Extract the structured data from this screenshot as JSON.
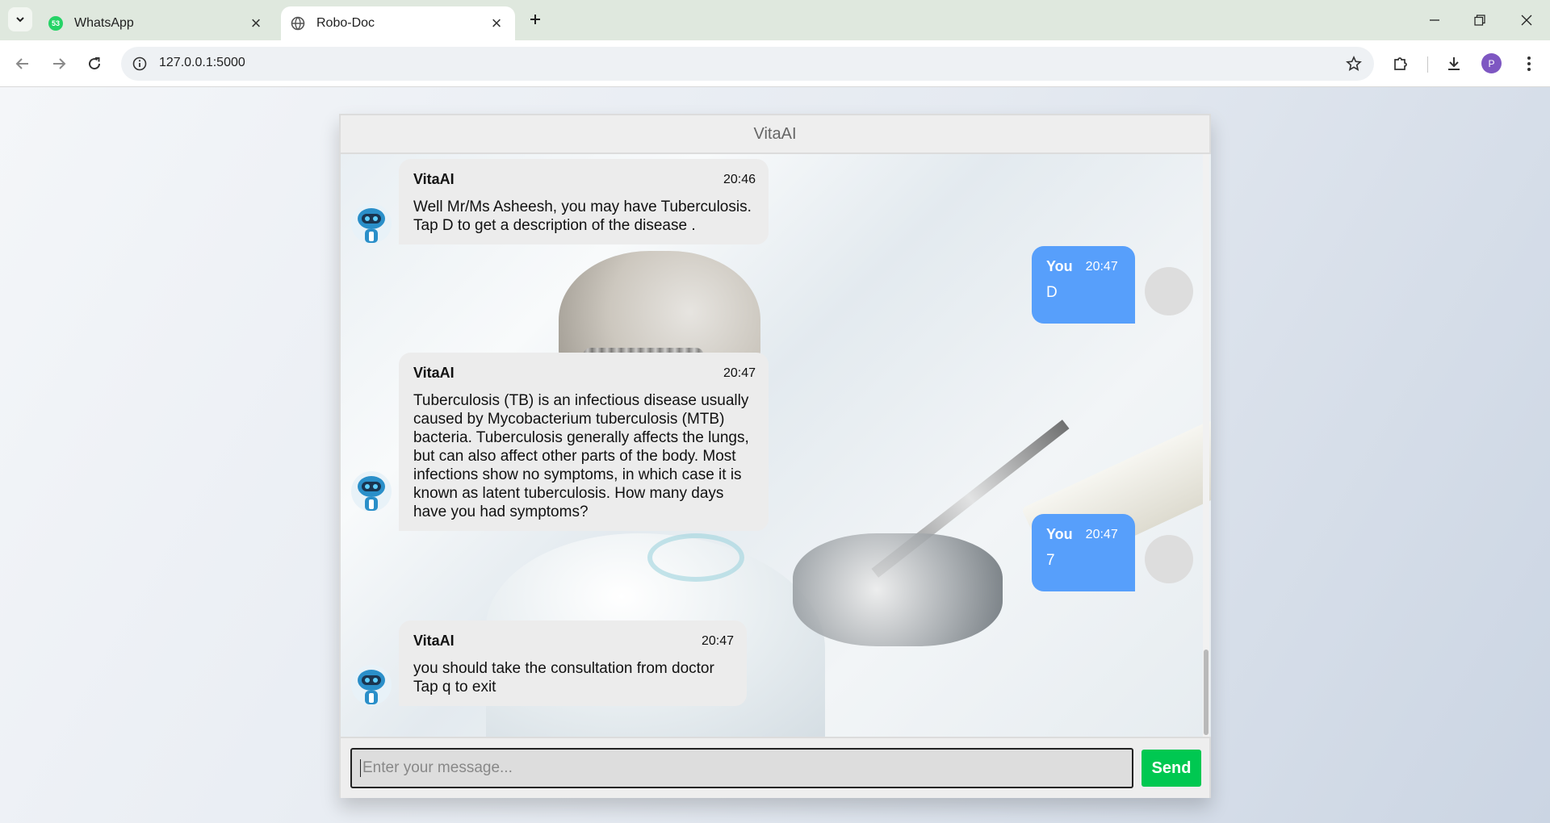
{
  "browser": {
    "tabs": [
      {
        "title": "WhatsApp",
        "favicon": "whatsapp-icon",
        "badge": "53",
        "active": false
      },
      {
        "title": "Robo-Doc",
        "favicon": "globe-icon",
        "active": true
      }
    ],
    "url": "127.0.0.1:5000",
    "profile_initial": "P"
  },
  "chat": {
    "header_title": "VitaAI",
    "messages": [
      {
        "sender": "VitaAI",
        "time": "20:46",
        "text": "Well Mr/Ms Asheesh, you may have Tuberculosis. Tap D to get a description of the disease ."
      },
      {
        "sender": "You",
        "time": "20:47",
        "text": "D"
      },
      {
        "sender": "VitaAI",
        "time": "20:47",
        "text": "Tuberculosis (TB) is an infectious disease usually caused by Mycobacterium tuberculosis (MTB) bacteria. Tuberculosis generally affects the lungs, but can also affect other parts of the body. Most infections show no symptoms, in which case it is known as latent tuberculosis. How many days have you had symptoms?"
      },
      {
        "sender": "You",
        "time": "20:47",
        "text": "7"
      },
      {
        "sender": "VitaAI",
        "time": "20:47",
        "text": "you should take the consultation from doctor Tap q to exit"
      }
    ],
    "input_placeholder": "Enter your message...",
    "send_label": "Send"
  },
  "colors": {
    "bot_bubble": "#ececec",
    "user_bubble": "#579ffb",
    "send_button": "#00c851",
    "tab_strip": "#dfe8de"
  }
}
